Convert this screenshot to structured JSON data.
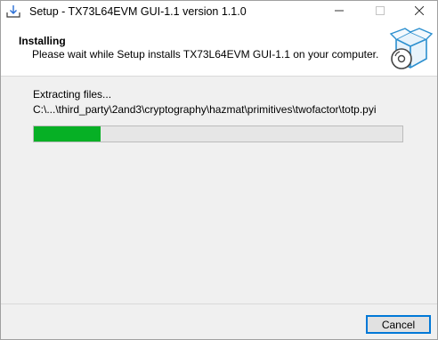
{
  "window": {
    "title": "Setup - TX73L64EVM GUI-1.1 version 1.1.0",
    "icon": "installer-download-icon",
    "controls": {
      "minimize_icon": "minimize-icon",
      "maximize_icon": "maximize-icon",
      "close_icon": "close-icon"
    }
  },
  "header": {
    "title": "Installing",
    "description": "Please wait while Setup installs TX73L64EVM GUI-1.1 on your computer.",
    "logo": "setup-box-disc-icon"
  },
  "main": {
    "status_label": "Extracting files...",
    "current_file": "C:\\...\\third_party\\2and3\\cryptography\\hazmat\\primitives\\twofactor\\totp.pyi",
    "progress": 0.18
  },
  "footer": {
    "cancel_label": "Cancel"
  },
  "colors": {
    "progress_fill": "#06b025",
    "progress_track": "#e6e6e6",
    "accent": "#0078d7"
  }
}
